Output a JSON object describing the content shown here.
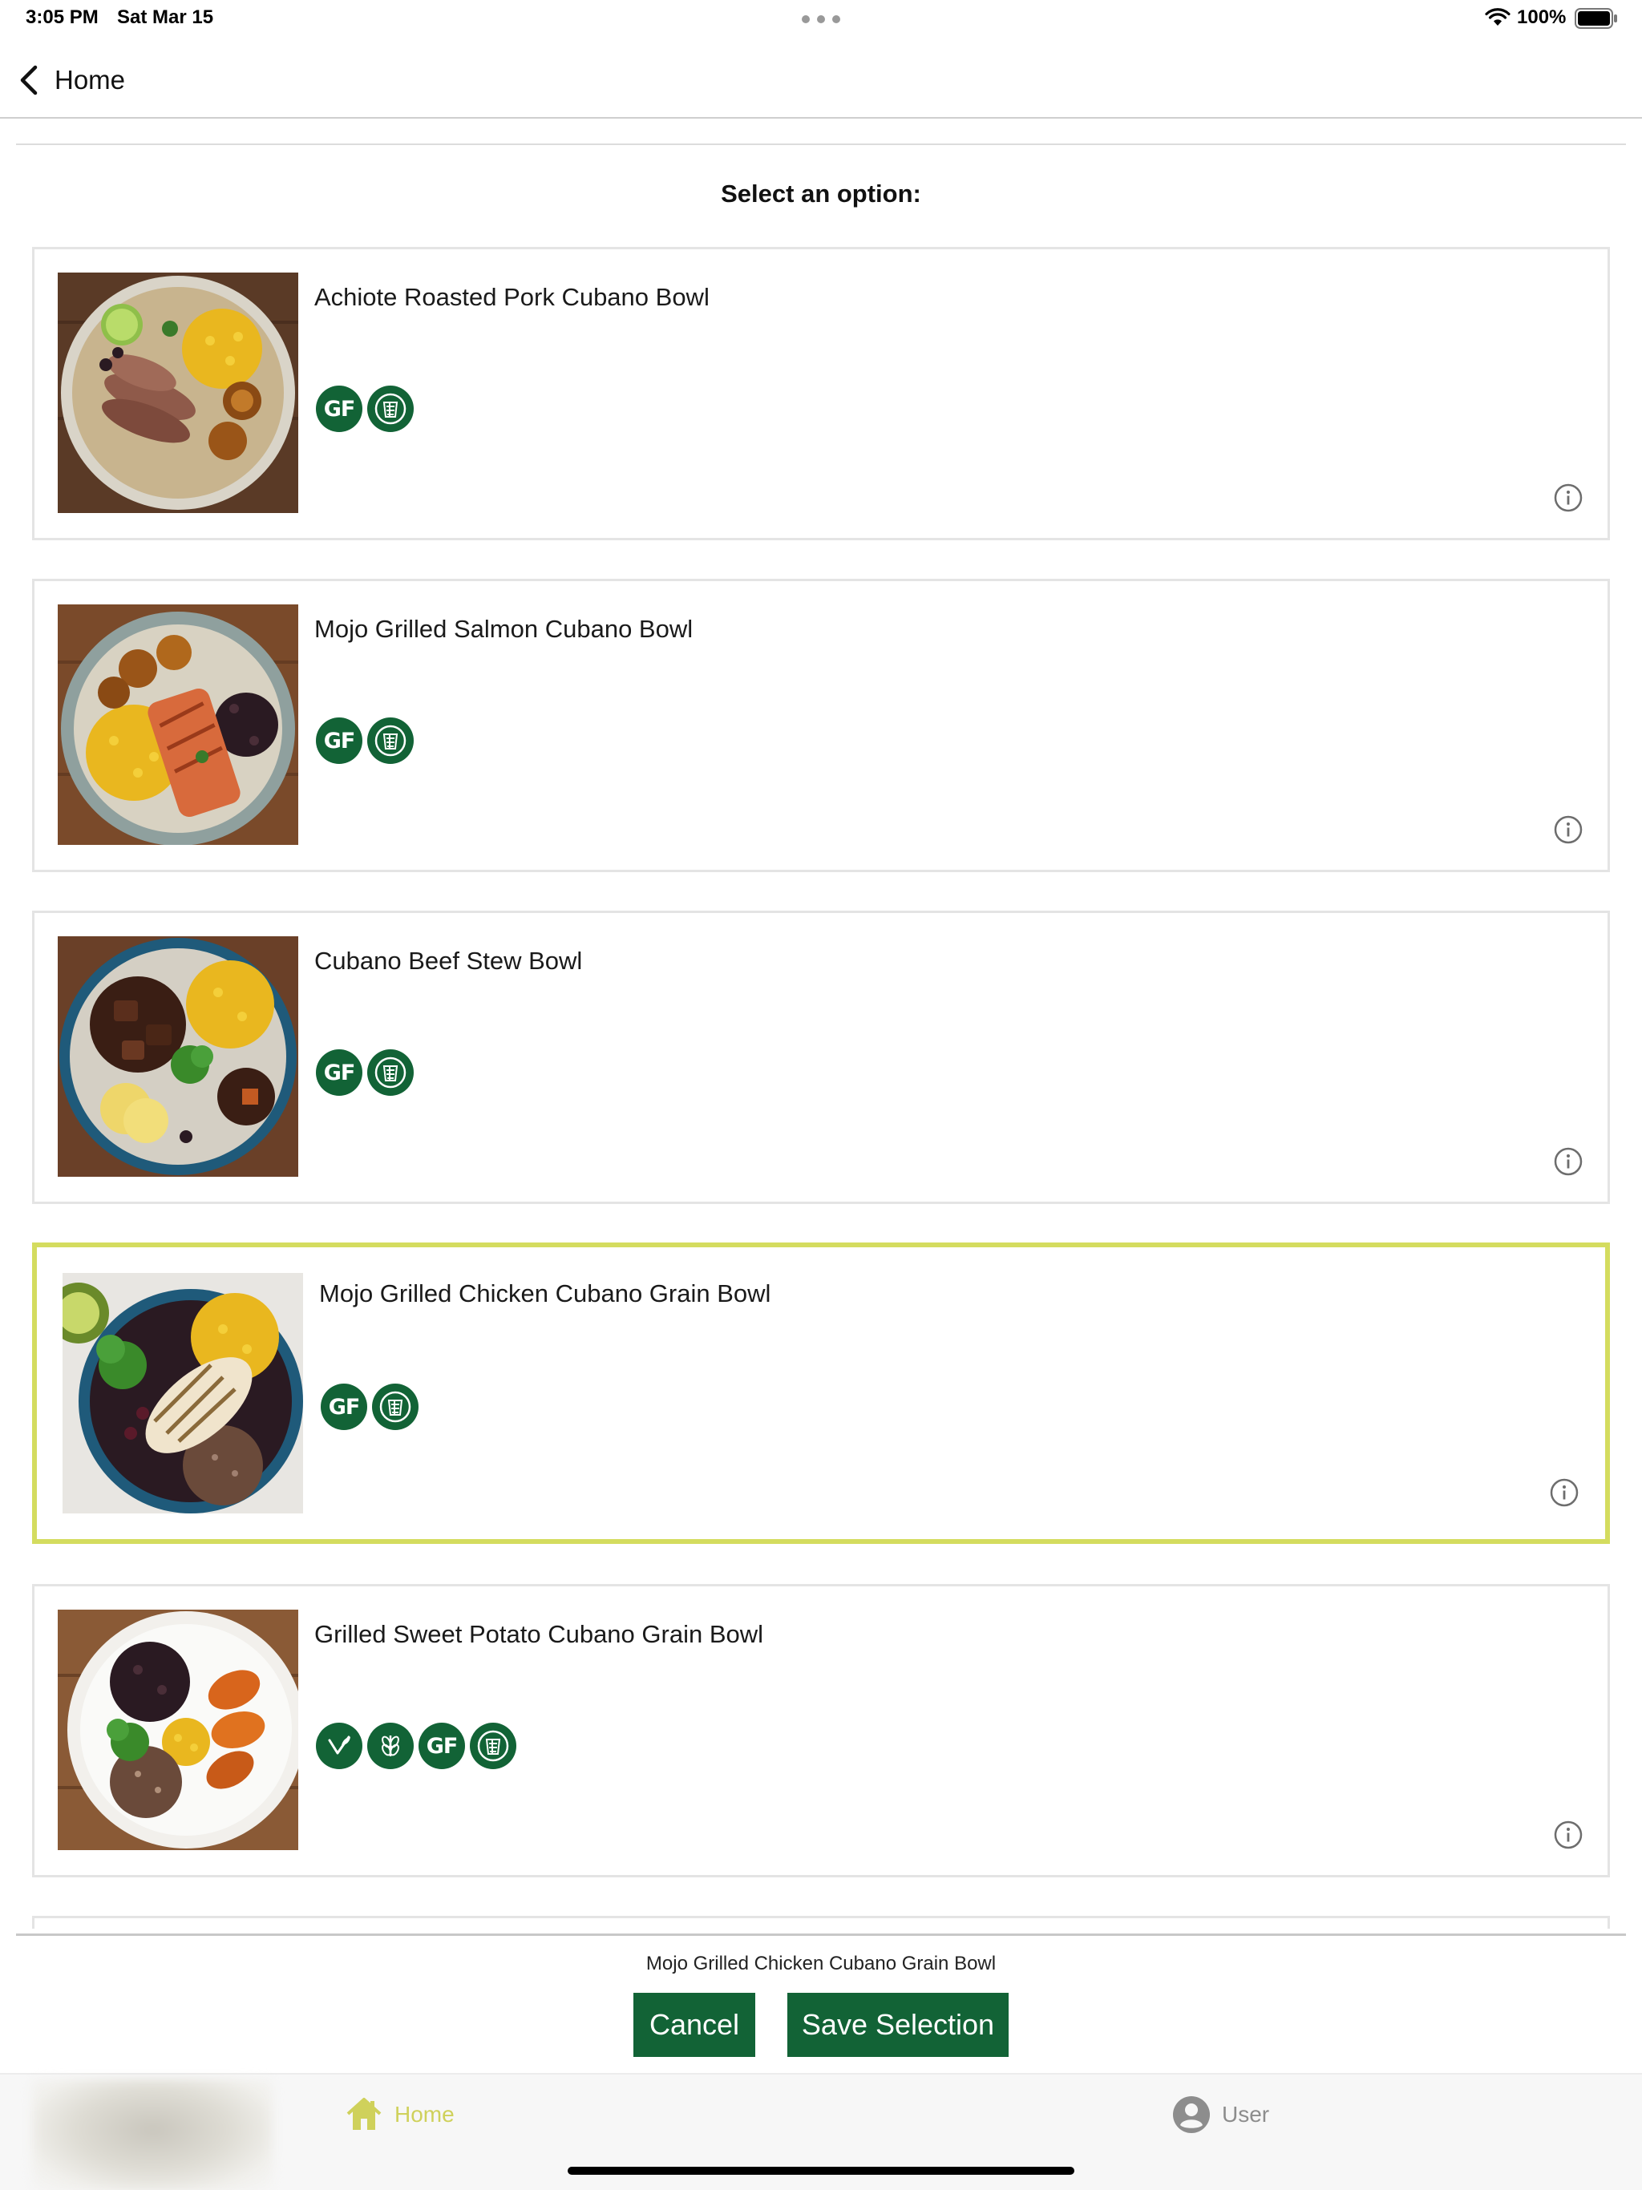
{
  "status_bar": {
    "time": "3:05 PM",
    "date": "Sat Mar 15",
    "battery": "100%"
  },
  "nav": {
    "back_label": "Home"
  },
  "page": {
    "title": "Select an option:"
  },
  "options": [
    {
      "name": "Achiote Roasted Pork Cubano Bowl",
      "badges": [
        "gluten-free",
        "whole-grain"
      ],
      "selected": false
    },
    {
      "name": "Mojo Grilled Salmon Cubano Bowl",
      "badges": [
        "gluten-free",
        "whole-grain"
      ],
      "selected": false
    },
    {
      "name": "Cubano Beef Stew Bowl",
      "badges": [
        "gluten-free",
        "whole-grain"
      ],
      "selected": false
    },
    {
      "name": "Mojo Grilled Chicken Cubano Grain Bowl",
      "badges": [
        "gluten-free",
        "whole-grain"
      ],
      "selected": true
    },
    {
      "name": "Grilled Sweet Potato Cubano Grain Bowl",
      "badges": [
        "vegan",
        "vegetarian",
        "gluten-free",
        "whole-grain"
      ],
      "selected": false
    }
  ],
  "badge_text": {
    "gluten_free": "GF"
  },
  "selection": {
    "summary": "Mojo Grilled Chicken Cubano Grain Bowl",
    "cancel_label": "Cancel",
    "save_label": "Save Selection"
  },
  "tabs": {
    "home_label": "Home",
    "user_label": "User"
  },
  "colors": {
    "brand_green": "#126336",
    "selected_border": "#d4dc5f",
    "active_tab": "#cfd15b"
  }
}
